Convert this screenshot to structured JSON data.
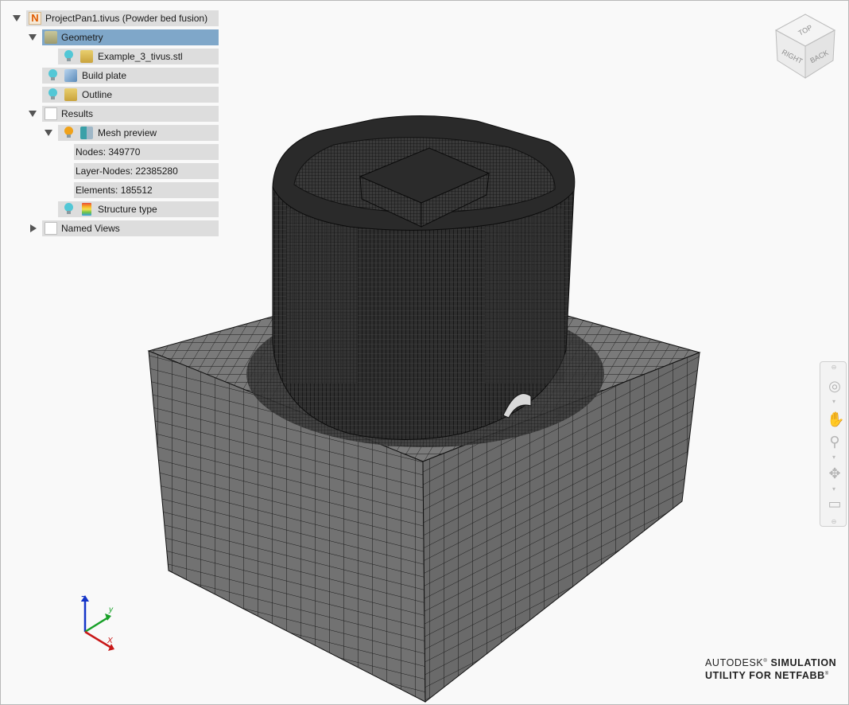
{
  "tree": {
    "project": "ProjectPan1.tivus (Powder bed fusion)",
    "geometry": "Geometry",
    "stl": "Example_3_tivus.stl",
    "build_plate": "Build plate",
    "outline": "Outline",
    "results": "Results",
    "mesh_preview": "Mesh preview",
    "nodes": "Nodes: 349770",
    "layer_nodes": "Layer-Nodes: 22385280",
    "elements": "Elements: 185512",
    "structure_type": "Structure type",
    "named_views": "Named Views"
  },
  "viewcube": {
    "top": "TOP",
    "right": "RIGHT",
    "back": "BACK"
  },
  "triad": {
    "z": "Z",
    "y": "y",
    "x": "X"
  },
  "brand": {
    "line1_regular": "AUTODESK",
    "line1_reg_mark": "®",
    "line1_bold": " SIMULATION",
    "line2": "UTILITY FOR NETFABB",
    "line2_reg_mark": "®"
  },
  "colors": {
    "selected_row": "#7fa7c9",
    "row_bg": "#dddddd",
    "mesh_face": "#6b6b6b",
    "mesh_lines": "#1c1c1c"
  },
  "icons": {
    "navbar": [
      "steering-wheel-icon",
      "pan-icon",
      "zoom-icon",
      "orbit-icon",
      "fit-view-icon"
    ]
  }
}
